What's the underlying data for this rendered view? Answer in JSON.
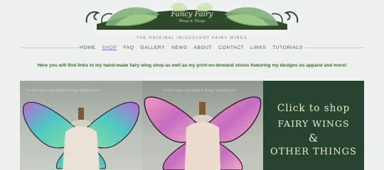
{
  "logo": {
    "line1": "Fancy Fairy",
    "line2": "Wings & Things"
  },
  "tagline": "THE ORIGINAL IRIDESCENT FAIRY WINGS",
  "nav": {
    "items": [
      "HOME",
      "SHOP",
      "FAQ",
      "GALLERY",
      "NEWS",
      "ABOUT",
      "CONTACT",
      "LINKS",
      "TUTORIALS"
    ],
    "active": "SHOP"
  },
  "intro": "Here you will find links to my hand-made fairy wing shop as well as my print-on-demand stores featuring my designs on apparel and more!",
  "banner": {
    "watermark1": "© 2022 Fancy Fairy Wings & Things / fancyfairy.com",
    "watermark2": "© 2022 Fancy Fairy Wings & Things / fancyfairy.com",
    "cta_line1": "Click to shop",
    "cta_line2": "FAIRY WINGS",
    "cta_line3": "&",
    "cta_line4": "OTHER THINGS"
  },
  "colors": {
    "accent": "#3e6b32",
    "nav_active": "#8a6bbf",
    "cta_bg": "#27442f"
  }
}
